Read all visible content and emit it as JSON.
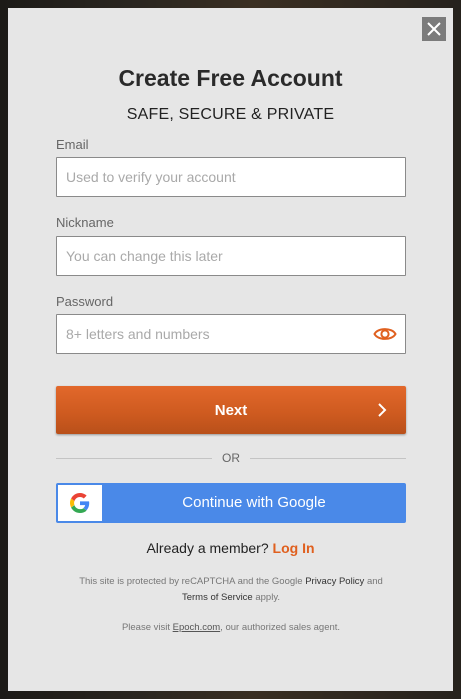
{
  "modal": {
    "title": "Create Free Account",
    "subtitle": "SAFE, SECURE & PRIVATE"
  },
  "email": {
    "label": "Email",
    "placeholder": "Used to verify your account",
    "value": ""
  },
  "nickname": {
    "label": "Nickname",
    "placeholder": "You can change this later",
    "value": ""
  },
  "password": {
    "label": "Password",
    "placeholder": "8+ letters and numbers",
    "value": ""
  },
  "next": {
    "label": "Next"
  },
  "divider": {
    "label": "OR"
  },
  "google": {
    "label": "Continue with Google"
  },
  "member": {
    "prompt": "Already a member?",
    "login_label": "Log In"
  },
  "recaptcha": {
    "prefix": "This site is protected by reCAPTCHA and the Google",
    "privacy_label": "Privacy Policy",
    "and": "and",
    "terms_label": "Terms of Service",
    "suffix": "apply."
  },
  "agent": {
    "prefix": "Please visit",
    "link_label": "Epoch.com",
    "suffix": ", our authorized sales agent."
  },
  "icons": {
    "close": "close-icon",
    "eye": "eye-icon",
    "chevron": "chevron-right-icon",
    "google": "google-logo-icon"
  },
  "colors": {
    "accent": "#e0601f",
    "google_blue": "#4a89e8",
    "modal_bg": "#e6e6e6"
  }
}
